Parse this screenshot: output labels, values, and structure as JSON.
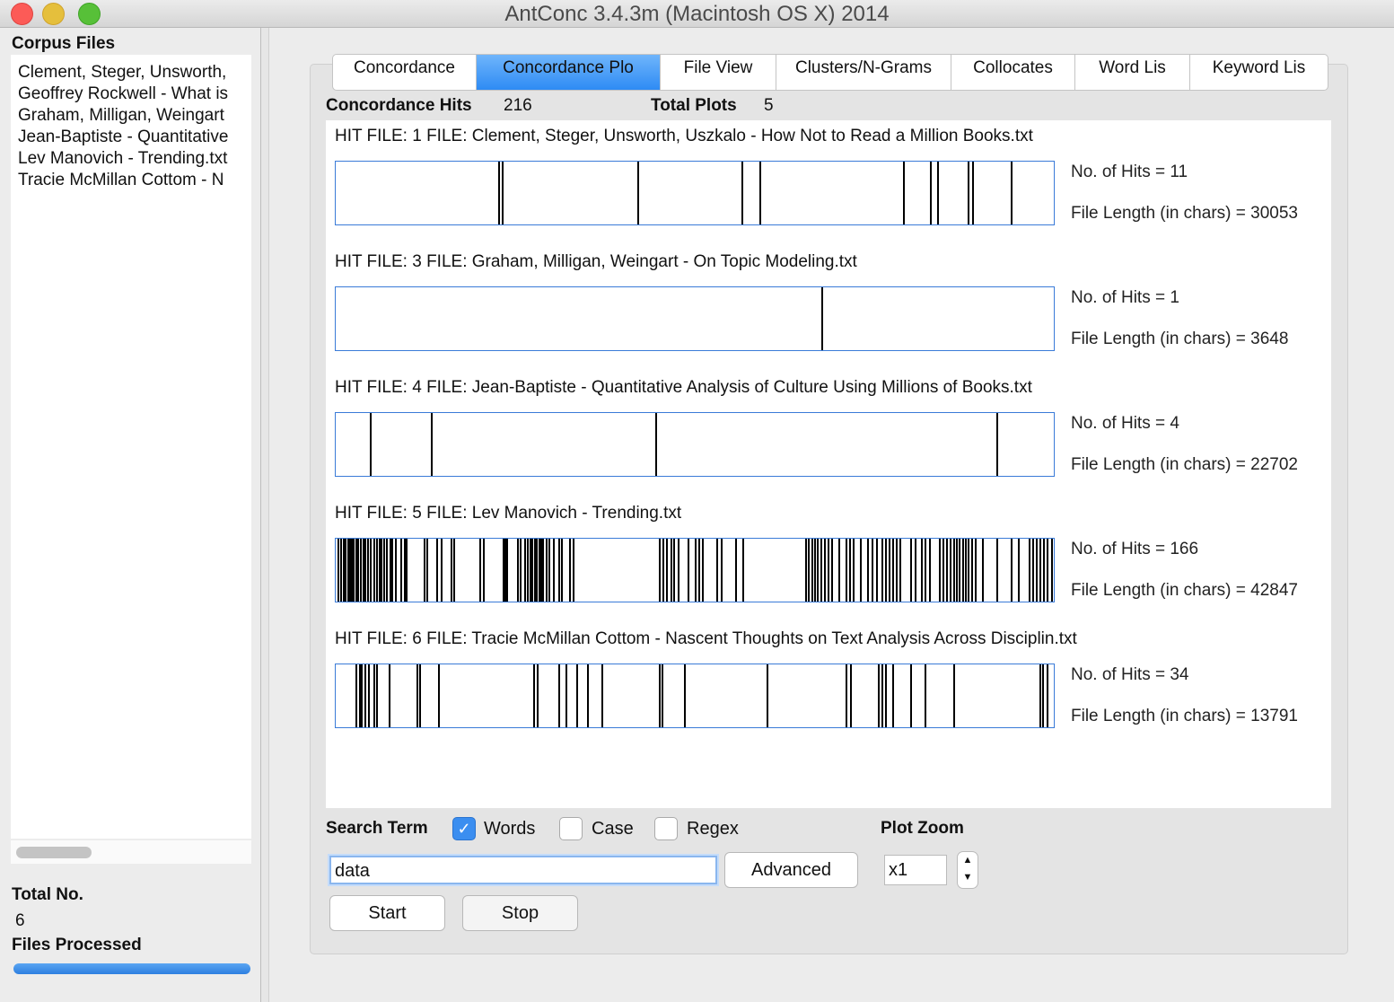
{
  "window": {
    "title": "AntConc 3.4.3m (Macintosh OS X) 2014",
    "colors": {
      "close": "#fc5b57",
      "minimize": "#e5bf3c",
      "zoom": "#57c038",
      "accent": "#2e8bf4"
    }
  },
  "sidebar": {
    "heading": "Corpus Files",
    "files": [
      "Clement, Steger, Unsworth,",
      "Geoffrey Rockwell - What is",
      "Graham, Milligan, Weingart",
      "Jean-Baptiste - Quantitative",
      "Lev Manovich - Trending.txt",
      "Tracie McMillan Cottom - N"
    ],
    "total_label": "Total No.",
    "total_value": "6",
    "processed_label": "Files Processed",
    "progress": 1.0
  },
  "tabs": [
    {
      "label": "Concordance",
      "active": false
    },
    {
      "label": "Concordance Plo",
      "active": true
    },
    {
      "label": "File View",
      "active": false
    },
    {
      "label": "Clusters/N-Grams",
      "active": false
    },
    {
      "label": "Collocates",
      "active": false
    },
    {
      "label": "Word Lis",
      "active": false
    },
    {
      "label": "Keyword Lis",
      "active": false
    }
  ],
  "stats": {
    "hits_label": "Concordance Hits",
    "hits_value": "216",
    "plots_label": "Total Plots",
    "plots_value": "5"
  },
  "plots": [
    {
      "label": "HIT FILE: 1    FILE: Clement, Steger, Unsworth, Uszkalo - How Not to Read a Million Books.txt",
      "hits": "No. of Hits = 11",
      "length": "File Length (in chars) = 30053",
      "marks": [
        0.226,
        0.231,
        0.42,
        0.565,
        0.59,
        0.79,
        0.828,
        0.838,
        0.88,
        0.886,
        0.94
      ]
    },
    {
      "label": "HIT FILE: 3    FILE: Graham, Milligan, Weingart - On Topic Modeling.txt",
      "hits": "No. of Hits = 1",
      "length": "File Length (in chars) = 3648",
      "marks": [
        0.676
      ]
    },
    {
      "label": "HIT FILE: 4    FILE: Jean-Baptiste - Quantitative Analysis of Culture Using Millions of Books.txt",
      "hits": "No. of Hits = 4",
      "length": "File Length (in chars) = 22702",
      "marks": [
        0.047,
        0.132,
        0.445,
        0.92
      ]
    },
    {
      "label": "HIT FILE: 5    FILE: Lev Manovich - Trending.txt",
      "hits": "No. of Hits = 166",
      "length": "File Length (in chars) = 42847",
      "marks": [
        0.003,
        0.006,
        0.01,
        0.013,
        0.016,
        0.019,
        0.021,
        0.024,
        0.027,
        0.03,
        0.034,
        0.037,
        0.04,
        0.044,
        0.048,
        0.052,
        0.056,
        0.06,
        0.063,
        0.066,
        0.07,
        0.075,
        0.078,
        0.082,
        0.09,
        0.095,
        0.098,
        0.122,
        0.126,
        0.14,
        0.146,
        0.16,
        0.164,
        0.2,
        0.205,
        0.232,
        0.235,
        0.238,
        0.252,
        0.256,
        0.262,
        0.266,
        0.27,
        0.273,
        0.276,
        0.279,
        0.282,
        0.285,
        0.288,
        0.292,
        0.296,
        0.303,
        0.31,
        0.314,
        0.325,
        0.33,
        0.45,
        0.455,
        0.46,
        0.466,
        0.47,
        0.476,
        0.49,
        0.5,
        0.505,
        0.51,
        0.53,
        0.536,
        0.556,
        0.566,
        0.654,
        0.658,
        0.662,
        0.666,
        0.67,
        0.675,
        0.68,
        0.685,
        0.69,
        0.7,
        0.71,
        0.715,
        0.72,
        0.73,
        0.74,
        0.746,
        0.752,
        0.76,
        0.765,
        0.77,
        0.775,
        0.78,
        0.785,
        0.8,
        0.806,
        0.815,
        0.82,
        0.826,
        0.84,
        0.845,
        0.85,
        0.855,
        0.86,
        0.864,
        0.868,
        0.872,
        0.876,
        0.88,
        0.885,
        0.89,
        0.9,
        0.92,
        0.94,
        0.95,
        0.965,
        0.97,
        0.975,
        0.98,
        0.985,
        0.99,
        0.996
      ]
    },
    {
      "label": "HIT FILE: 6    FILE: Tracie McMillan Cottom - Nascent Thoughts on Text Analysis Across Disciplin.txt",
      "hits": "No. of Hits = 34",
      "length": "File Length (in chars) = 13791",
      "marks": [
        0.028,
        0.032,
        0.035,
        0.04,
        0.045,
        0.052,
        0.056,
        0.074,
        0.112,
        0.116,
        0.142,
        0.275,
        0.28,
        0.31,
        0.32,
        0.335,
        0.35,
        0.37,
        0.45,
        0.454,
        0.485,
        0.6,
        0.71,
        0.716,
        0.755,
        0.76,
        0.765,
        0.775,
        0.8,
        0.82,
        0.86,
        0.98,
        0.984,
        0.99
      ]
    }
  ],
  "search": {
    "term_label": "Search Term",
    "words_label": "Words",
    "words_checked": true,
    "case_label": "Case",
    "case_checked": false,
    "regex_label": "Regex",
    "regex_checked": false,
    "value": "data",
    "advanced_label": "Advanced",
    "start_label": "Start",
    "stop_label": "Stop"
  },
  "zoom": {
    "label": "Plot Zoom",
    "value": "x1"
  }
}
